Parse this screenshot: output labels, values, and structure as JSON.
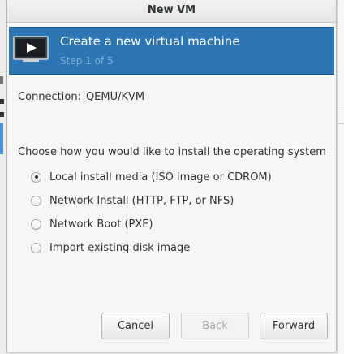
{
  "window": {
    "title": "New VM"
  },
  "banner": {
    "title": "Create a new virtual machine",
    "step": "Step 1 of 5",
    "icon": "vm-screen-play-icon"
  },
  "connection": {
    "label": "Connection:",
    "value": "QEMU/KVM"
  },
  "install": {
    "prompt": "Choose how you would like to install the operating system",
    "options": [
      {
        "label": "Local install media (ISO image or CDROM)",
        "selected": true
      },
      {
        "label": "Network Install (HTTP, FTP, or NFS)",
        "selected": false
      },
      {
        "label": "Network Boot (PXE)",
        "selected": false
      },
      {
        "label": "Import existing disk image",
        "selected": false
      }
    ]
  },
  "buttons": {
    "cancel": "Cancel",
    "back": "Back",
    "forward": "Forward"
  },
  "colors": {
    "banner_bg": "#2c76b3",
    "banner_step_text": "#7fb3de"
  }
}
